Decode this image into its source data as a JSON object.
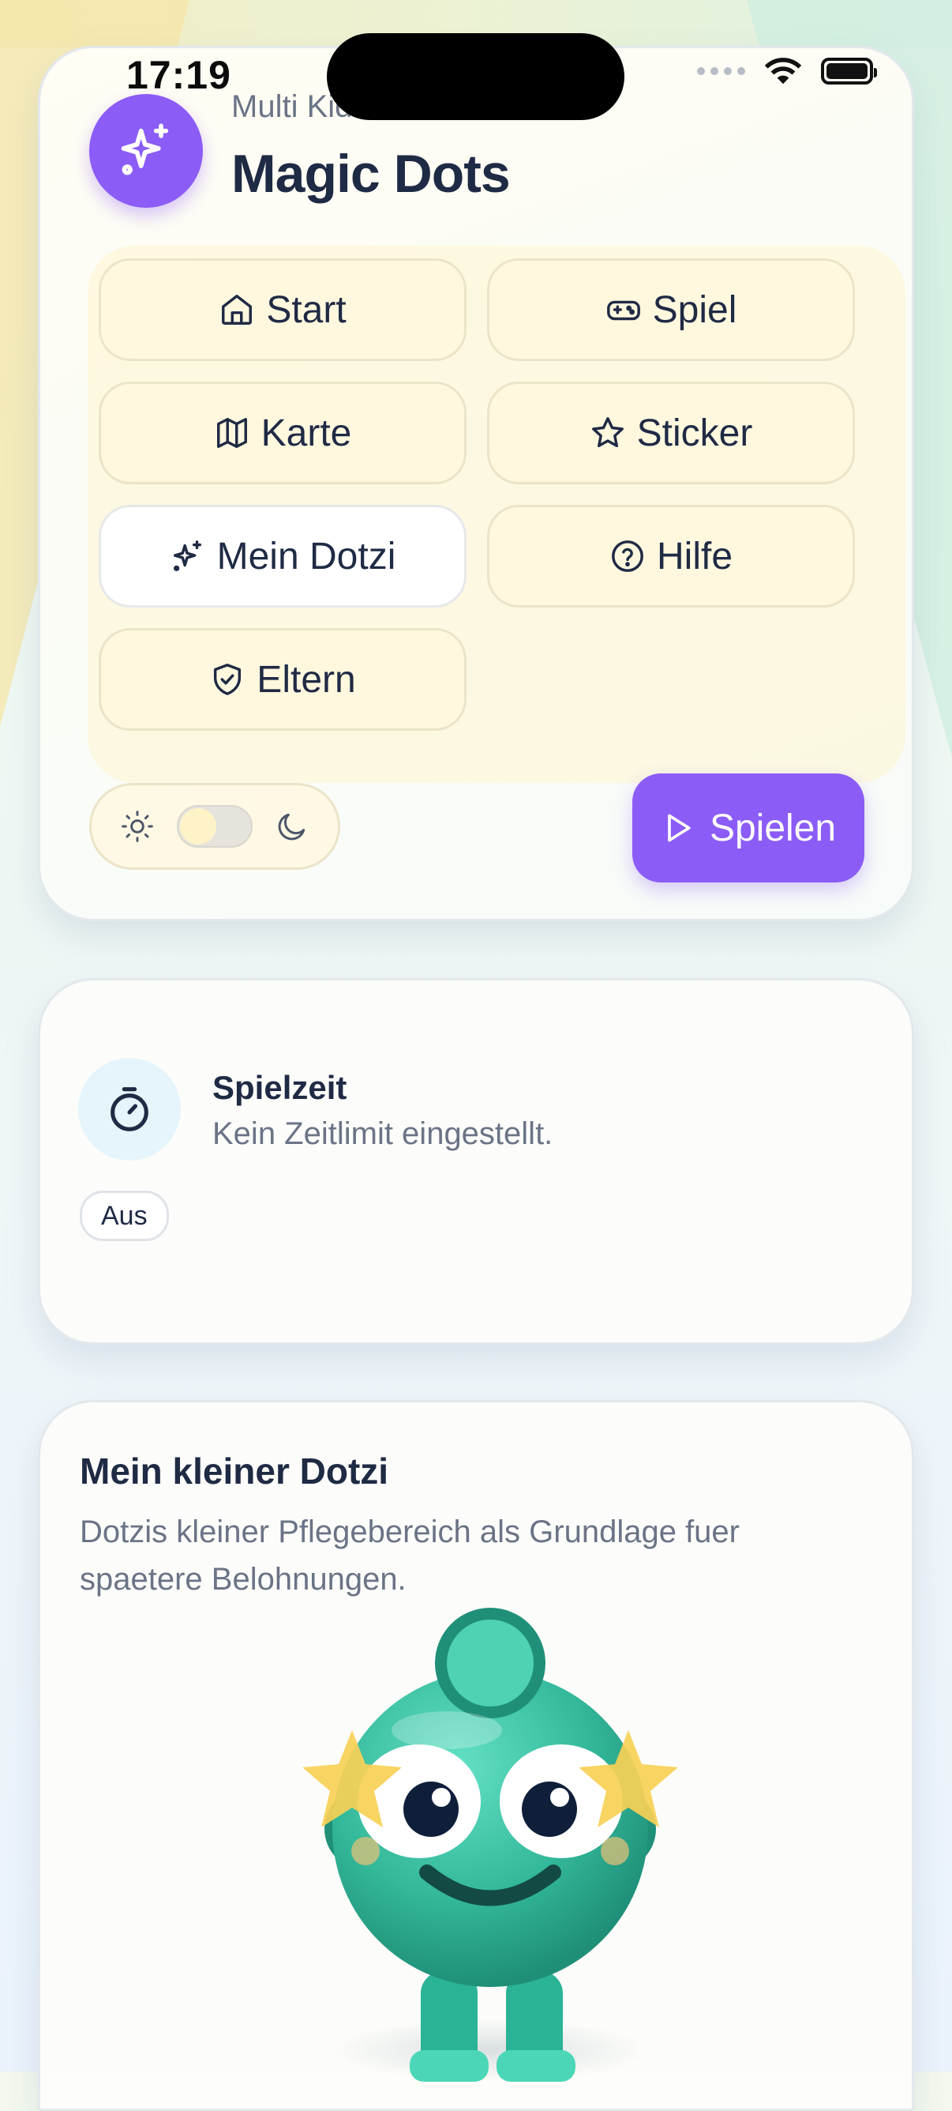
{
  "status_bar": {
    "time": "17:19"
  },
  "app": {
    "subtitle": "Multi Kids Games",
    "title": "Magic Dots",
    "accent_color": "#8b5cf6"
  },
  "nav": [
    {
      "label": "Start",
      "icon": "home-icon",
      "active": false
    },
    {
      "label": "Spiel",
      "icon": "gamepad-icon",
      "active": false
    },
    {
      "label": "Karte",
      "icon": "map-icon",
      "active": false
    },
    {
      "label": "Sticker",
      "icon": "star-icon",
      "active": false
    },
    {
      "label": "Mein Dotzi",
      "icon": "sparkles-icon",
      "active": true
    },
    {
      "label": "Hilfe",
      "icon": "help-circle-icon",
      "active": false
    },
    {
      "label": "Eltern",
      "icon": "shield-check-icon",
      "active": false
    }
  ],
  "theme": {
    "light_icon": "sun-icon",
    "dark_icon": "moon-icon",
    "mode": "light"
  },
  "play_button": {
    "label": "Spielen",
    "icon": "play-icon"
  },
  "playtime": {
    "title": "Spielzeit",
    "text": "Kein Zeitlimit eingestellt.",
    "badge": "Aus",
    "icon": "timer-icon"
  },
  "dotzi": {
    "title": "Mein kleiner Dotzi",
    "description": "Dotzis kleiner Pflegebereich als Grundlage fuer spaetere Belohnungen.",
    "mascot_color": "#3fc7a8"
  }
}
